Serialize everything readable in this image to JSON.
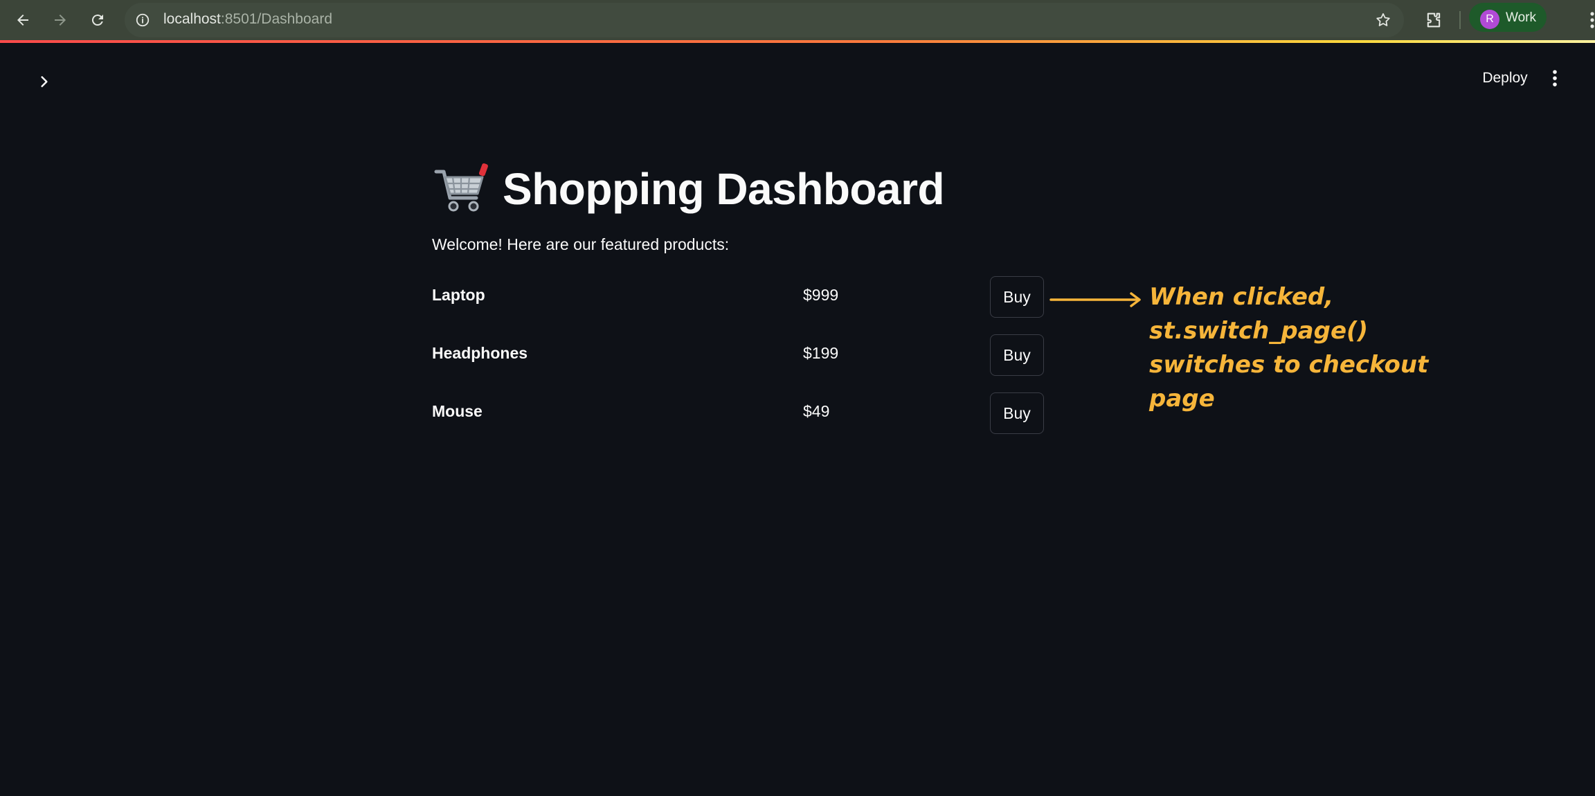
{
  "browser": {
    "url_host": "localhost",
    "url_path": ":8501/Dashboard",
    "profile_initial": "R",
    "profile_label": "Work"
  },
  "header": {
    "deploy_label": "Deploy"
  },
  "page": {
    "title": "Shopping Dashboard",
    "welcome": "Welcome! Here are our featured products:"
  },
  "products": [
    {
      "name": "Laptop",
      "price": "$999",
      "button": "Buy"
    },
    {
      "name": "Headphones",
      "price": "$199",
      "button": "Buy"
    },
    {
      "name": "Mouse",
      "price": "$49",
      "button": "Buy"
    }
  ],
  "annotation": {
    "lines": [
      "When clicked,",
      "st.switch_page()",
      "switches to checkout",
      "page"
    ]
  },
  "colors": {
    "background": "#0e1117",
    "chrome": "#3c4539",
    "annotation": "#f6b53a",
    "avatar": "#b14ad6"
  },
  "icons": [
    "back-icon",
    "forward-icon",
    "reload-icon",
    "info-icon",
    "star-icon",
    "extensions-icon",
    "chrome-menu-icon",
    "chevron-right-icon",
    "kebab-menu-icon",
    "shopping-cart-icon",
    "arrow-icon"
  ]
}
